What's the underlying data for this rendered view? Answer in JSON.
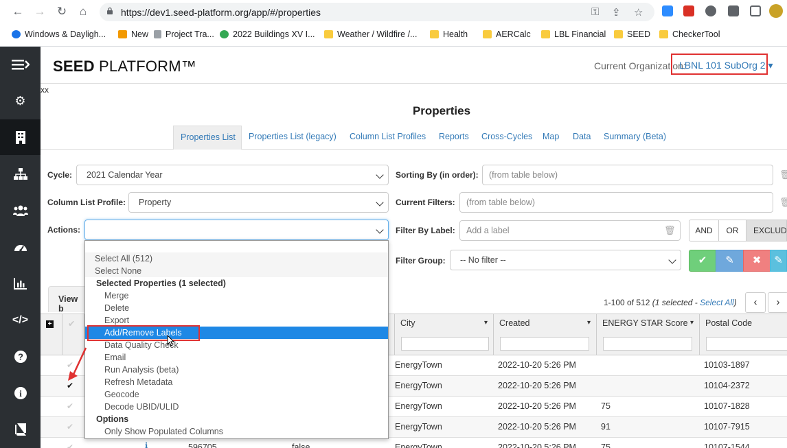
{
  "browser": {
    "url": "https://dev1.seed-platform.org/app/#/properties",
    "bookmarks": [
      {
        "label": "Windows & Dayligh...",
        "color": "#1a73e8"
      },
      {
        "label": "New",
        "color": "#f29900"
      },
      {
        "label": "Project Tra...",
        "color": "#9aa0a6"
      },
      {
        "label": "2022 Buildings XV I...",
        "color": "#34a853"
      },
      {
        "label": "Weather / Wildfire /...",
        "color": "#f9cb3d"
      },
      {
        "label": "Health",
        "color": "#f9cb3d"
      },
      {
        "label": "AERCalc",
        "color": "#f9cb3d"
      },
      {
        "label": "LBL Financial",
        "color": "#f9cb3d"
      },
      {
        "label": "SEED",
        "color": "#f9cb3d"
      },
      {
        "label": "CheckerTool",
        "color": "#f9cb3d"
      }
    ]
  },
  "header": {
    "logo_bold": "SEED",
    "logo_rest": " PLATFORM™",
    "org_label": "Current Organization:",
    "org_name": "LBNL 101 SubOrg 2 ▾",
    "xx": "xx"
  },
  "page": {
    "title": "Properties",
    "tabs": [
      "Properties List",
      "Properties List (legacy)",
      "Column List Profiles",
      "Reports",
      "Cross-Cycles",
      "Map",
      "Data",
      "Summary (Beta)"
    ]
  },
  "form": {
    "cycle_label": "Cycle:",
    "cycle_value": "2021 Calendar Year",
    "profile_label": "Column List Profile:",
    "profile_value": "Property",
    "actions_label": "Actions:",
    "actions_value": "",
    "sorting_label": "Sorting By (in order):",
    "sorting_placeholder": "(from table below)",
    "filters_label": "Current Filters:",
    "filters_placeholder": "(from table below)",
    "filter_label_label": "Filter By Label:",
    "filter_label_placeholder": "Add a label",
    "and_label": "AND",
    "or_label": "OR",
    "exclude_label": "EXCLUDE",
    "filter_group_label": "Filter Group:",
    "filter_group_value": "-- No filter --"
  },
  "dropdown": {
    "select_all": "Select All (512)",
    "select_none": "Select None",
    "group_selected": "Selected Properties (1 selected)",
    "items": [
      "Merge",
      "Delete",
      "Export",
      "Add/Remove Labels",
      "Data Quality Check",
      "Email",
      "Run Analysis (beta)",
      "Refresh Metadata",
      "Geocode",
      "Decode UBID/ULID"
    ],
    "selected_item": "Add/Remove Labels",
    "group_options": "Options",
    "option_items": [
      "Only Show Populated Columns"
    ]
  },
  "table": {
    "view_by": "View b",
    "pager_text": "1-100 of 512 ",
    "pager_selected": "(1 selected - ",
    "pager_select_all": "Select All",
    "pager_close": ")",
    "columns": [
      "City",
      "Created",
      "ENERGY STAR Score",
      "Postal Code"
    ],
    "rows": [
      {
        "city": "EnergyTown",
        "created": "2022-10-20 5:26 PM",
        "score": "",
        "postal": "10103-1897",
        "checked": false
      },
      {
        "city": "EnergyTown",
        "created": "2022-10-20 5:26 PM",
        "score": "",
        "postal": "10104-2372",
        "checked": true
      },
      {
        "city": "EnergyTown",
        "created": "2022-10-20 5:26 PM",
        "score": "75",
        "postal": "10107-1828",
        "checked": false
      },
      {
        "city": "EnergyTown",
        "created": "2022-10-20 5:26 PM",
        "score": "91",
        "postal": "10107-7915",
        "checked": false
      },
      {
        "city": "EnergyTown",
        "created": "2022-10-20 5:26 PM",
        "score": "75",
        "postal": "10107-1544",
        "checked": false
      }
    ],
    "partial_row": {
      "id": "596705",
      "flag": "false"
    }
  },
  "colors": {
    "sidebar": "#2b2f33",
    "link": "#337ab7",
    "highlight_red": "#e03131",
    "selected_blue": "#1e88e5",
    "btn_green": "#6fcf7b",
    "btn_blue": "#6fa8dc",
    "btn_red": "#f08080"
  },
  "sidebar_icons": [
    "menu-toggle-icon",
    "gear-icon",
    "building-icon",
    "org-chart-icon",
    "users-icon",
    "dashboard-gauge-icon",
    "bar-chart-icon",
    "code-icon",
    "help-icon",
    "info-icon",
    "book-icon"
  ]
}
